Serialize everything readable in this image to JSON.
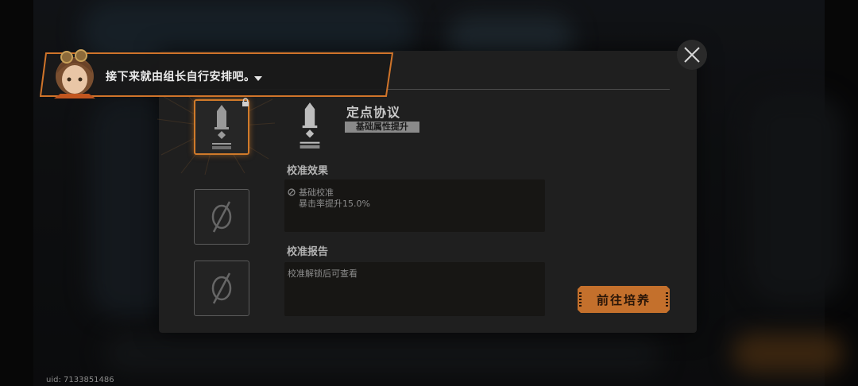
{
  "dialogue": {
    "text": "接下来就由组长自行安排吧。",
    "avatar_icon": "character-portrait"
  },
  "protocol": {
    "name": "定点协议",
    "tag": "基础属性提升",
    "icon": "sword-emblem-icon"
  },
  "calibration_effect": {
    "label": "校准效果",
    "line1": "基础校准",
    "line2": "暴击率提升15.0%"
  },
  "calibration_report": {
    "label": "校准报告",
    "text": "校准解锁后可查看"
  },
  "buttons": {
    "go_train": "前往培养"
  },
  "footer": {
    "uid": "uid: 7133851486"
  },
  "colors": {
    "accent": "#c4702c",
    "modal_bg": "#1f1f1f",
    "panel_bg": "#171614"
  }
}
